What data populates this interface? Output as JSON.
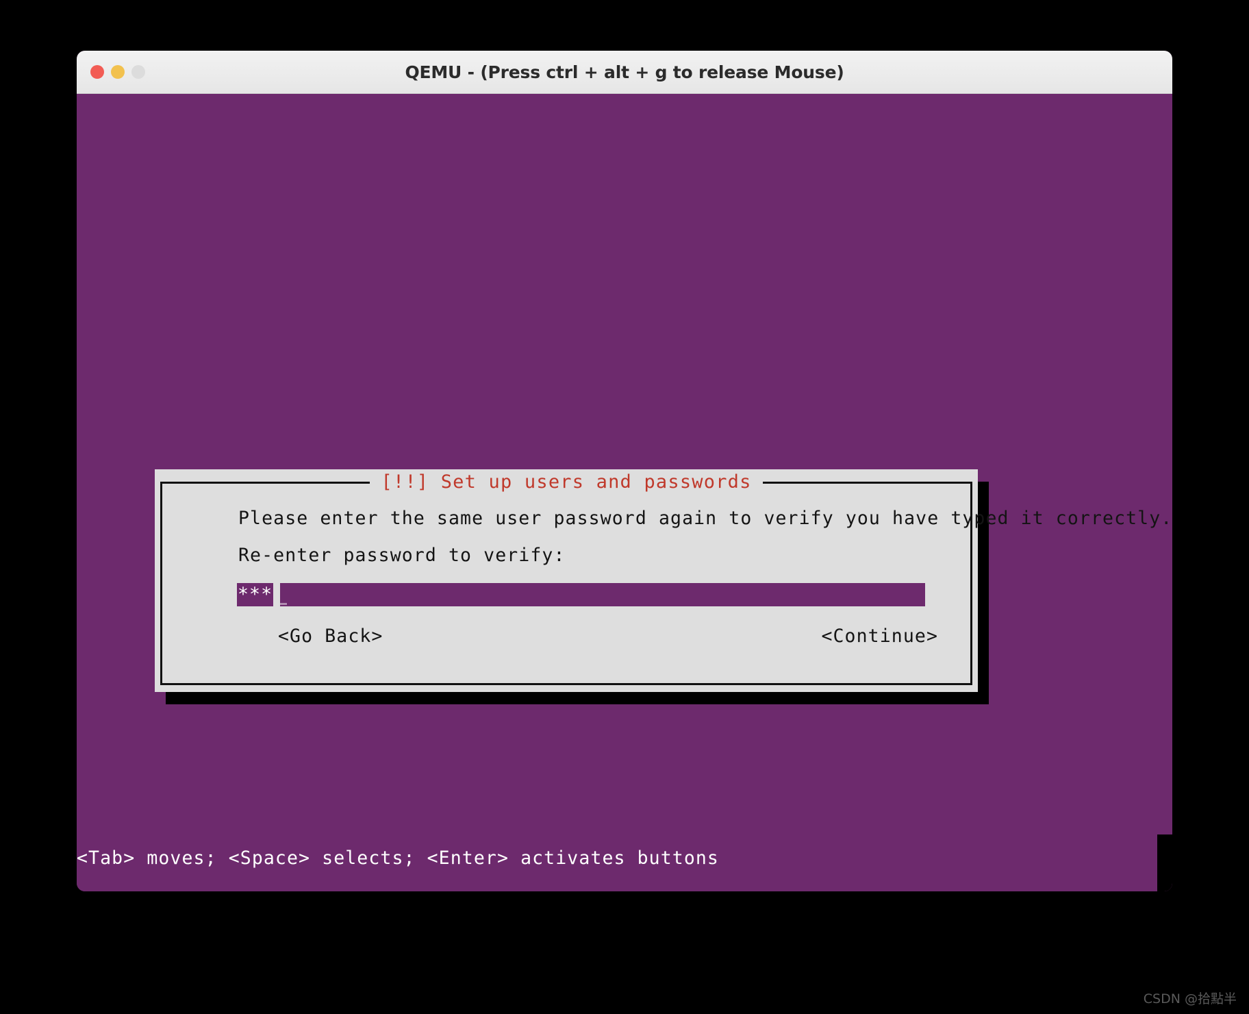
{
  "window": {
    "title": "QEMU - (Press ctrl + alt + g to release Mouse)",
    "traffic_lights": {
      "close_label": "close",
      "minimize_label": "minimize",
      "zoom_label": "zoom"
    }
  },
  "vm": {
    "background_color": "#6d2a6d",
    "helper_bar_text": "<Tab> moves; <Space> selects; <Enter> activates buttons"
  },
  "dialog": {
    "title": "[!!] Set up users and passwords",
    "title_color": "#c0392b",
    "background_color": "#dedede",
    "border_color": "#111111",
    "prompt_text": "Please enter the same user password again to verify you have typed it correctly.",
    "field_label": "Re-enter password to verify:",
    "password_field": {
      "masked_value": "***",
      "mask_character": "*",
      "placeholder": "",
      "fill_dashes": "______________________________________________________________________________________________",
      "field_color": "#6d2a6d"
    },
    "buttons": {
      "go_back": "<Go Back>",
      "continue": "<Continue>"
    }
  },
  "watermark": {
    "text": "CSDN @拾點半"
  }
}
